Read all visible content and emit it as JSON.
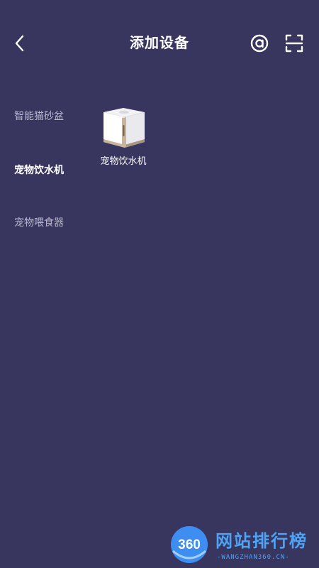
{
  "header": {
    "title": "添加设备",
    "back_icon": "chevron-left-icon",
    "at_icon": "at-sign-icon",
    "scan_icon": "scan-frame-icon"
  },
  "categories": [
    {
      "label": "智能猫砂盆",
      "active": false
    },
    {
      "label": "宠物饮水机",
      "active": true
    },
    {
      "label": "宠物喂食器",
      "active": false
    }
  ],
  "devices": [
    {
      "label": "宠物饮水机",
      "icon": "pet-water-fountain-image"
    }
  ],
  "watermark": {
    "logo": "360",
    "title": "网站排行榜",
    "subtitle": "-WANGZHAN360.CN-"
  },
  "colors": {
    "background": "#38355e",
    "text": "#ffffff",
    "inactive_text": "#b8b6cc",
    "watermark_blue": "#4fa3f5"
  }
}
